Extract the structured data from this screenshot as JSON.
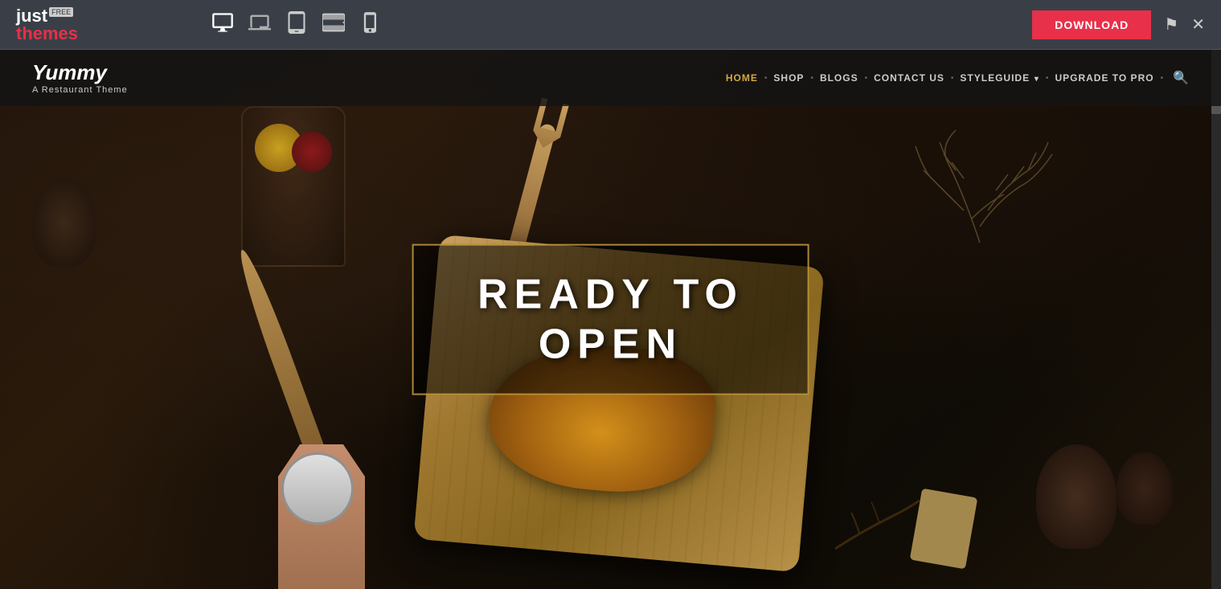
{
  "toolbar": {
    "logo_just": "just",
    "logo_free": "FREE",
    "logo_themes": "themes",
    "download_label": "DOWNLOAD",
    "devices": [
      {
        "name": "desktop",
        "label": "Desktop",
        "active": true
      },
      {
        "name": "laptop",
        "label": "Laptop",
        "active": false
      },
      {
        "name": "tablet",
        "label": "Tablet",
        "active": false
      },
      {
        "name": "tablet-small",
        "label": "Tablet Small",
        "active": false
      },
      {
        "name": "mobile",
        "label": "Mobile",
        "active": false
      }
    ]
  },
  "site": {
    "name": "Yummy",
    "tagline": "A Restaurant Theme",
    "nav": {
      "items": [
        {
          "label": "HOME",
          "active": true
        },
        {
          "label": "SHOP",
          "active": false
        },
        {
          "label": "BLOGS",
          "active": false
        },
        {
          "label": "CONTACT US",
          "active": false
        },
        {
          "label": "STYLEGUIDE",
          "active": false,
          "dropdown": true
        },
        {
          "label": "UPGRADE TO PRO",
          "active": false
        }
      ]
    },
    "hero": {
      "title_line1": "READY TO",
      "title_line2": "OPEN"
    }
  }
}
